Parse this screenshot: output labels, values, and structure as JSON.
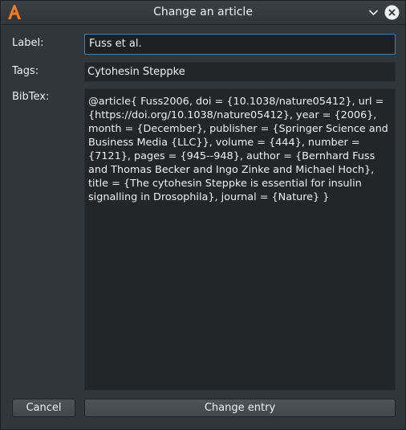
{
  "window": {
    "title": "Change an article",
    "app_icon": "app-logo-icon",
    "minimize_icon": "chevron-down-icon",
    "close_icon": "close-icon"
  },
  "form": {
    "label": {
      "caption": "Label:",
      "value": "Fuss et al."
    },
    "tags": {
      "caption": "Tags:",
      "value": "Cytohesin Steppke"
    },
    "bibtex": {
      "caption": "BibTex:",
      "value": "@article{ Fuss2006, doi = {10.1038/nature05412}, url = {https://doi.org/10.1038/nature05412}, year = {2006}, month = {December}, publisher = {Springer Science and Business Media {LLC}}, volume = {444}, number = {7121}, pages = {945--948}, author = {Bernhard Fuss and Thomas Becker and Ingo Zinke and Michael Hoch}, title = {The cytohesin Steppke is essential for insulin signalling in Drosophila}, journal = {Nature} }"
    }
  },
  "buttons": {
    "cancel": "Cancel",
    "change": "Change entry"
  },
  "colors": {
    "background": "#31363b",
    "field_background": "#232629",
    "accent": "#3daee9",
    "logo": "#f47b20"
  }
}
